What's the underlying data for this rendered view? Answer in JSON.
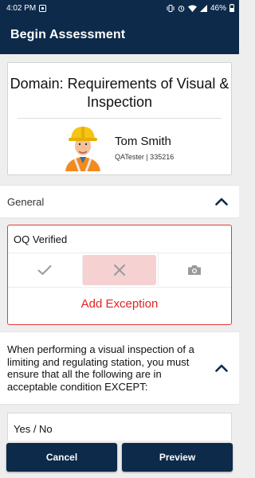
{
  "status_bar": {
    "time": "4:02 PM",
    "battery": "46%"
  },
  "app_bar": {
    "title": "Begin Assessment"
  },
  "domain_card": {
    "title": "Domain: Requirements of Visual & Inspection",
    "user_name": "Tom Smith",
    "user_meta": "QATester | 335216"
  },
  "section": {
    "label": "General"
  },
  "oq_card": {
    "label": "OQ Verified",
    "actions": [
      {
        "icon": "checkmark-icon",
        "selected": false
      },
      {
        "icon": "x-mark-icon",
        "selected": true
      },
      {
        "icon": "camera-icon",
        "selected": false
      }
    ],
    "add_exception_label": "Add Exception"
  },
  "question": {
    "text": "When performing a visual inspection of a  limiting and regulating station, you must ensure that all the following are in acceptable condition EXCEPT:"
  },
  "answer": {
    "label": "Yes / No"
  },
  "footer": {
    "cancel_label": "Cancel",
    "preview_label": "Preview"
  },
  "colors": {
    "primary": "#0d2a4a",
    "error": "#e02424",
    "selected_bg": "#f6d1d1",
    "background": "#eeeeee"
  }
}
